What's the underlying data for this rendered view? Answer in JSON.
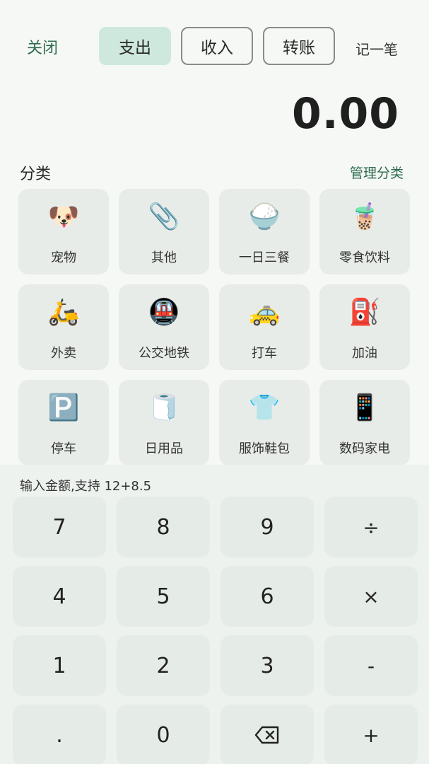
{
  "header": {
    "close_label": "关闭",
    "tabs": [
      {
        "label": "支出",
        "active": true
      },
      {
        "label": "收入",
        "active": false
      },
      {
        "label": "转账",
        "active": false
      }
    ],
    "note_label": "记一笔"
  },
  "amount": "0.00",
  "categories_section": {
    "title": "分类",
    "manage_label": "管理分类",
    "items": [
      {
        "emoji": "🐶",
        "label": "宠物",
        "icon": "dog-icon"
      },
      {
        "emoji": "📎",
        "label": "其他",
        "icon": "paperclip-icon"
      },
      {
        "emoji": "🍚",
        "label": "一日三餐",
        "icon": "rice-bowl-icon"
      },
      {
        "emoji": "🧋",
        "label": "零食饮料",
        "icon": "bubble-tea-icon"
      },
      {
        "emoji": "🛵",
        "label": "外卖",
        "icon": "scooter-icon"
      },
      {
        "emoji": "🚇",
        "label": "公交地铁",
        "icon": "metro-icon"
      },
      {
        "emoji": "🚕",
        "label": "打车",
        "icon": "taxi-icon"
      },
      {
        "emoji": "⛽",
        "label": "加油",
        "icon": "fuel-pump-icon"
      },
      {
        "emoji": "🅿️",
        "label": "停车",
        "icon": "parking-icon"
      },
      {
        "emoji": "🧻",
        "label": "日用品",
        "icon": "toilet-paper-icon"
      },
      {
        "emoji": "👕",
        "label": "服饰鞋包",
        "icon": "tshirt-icon"
      },
      {
        "emoji": "📱",
        "label": "数码家电",
        "icon": "phone-icon"
      }
    ]
  },
  "keypad": {
    "hint": "输入金额,支持 12+8.5",
    "keys": [
      "7",
      "8",
      "9",
      "÷",
      "4",
      "5",
      "6",
      "×",
      "1",
      "2",
      "3",
      "-",
      ".",
      "0",
      "⌫",
      "+"
    ]
  }
}
